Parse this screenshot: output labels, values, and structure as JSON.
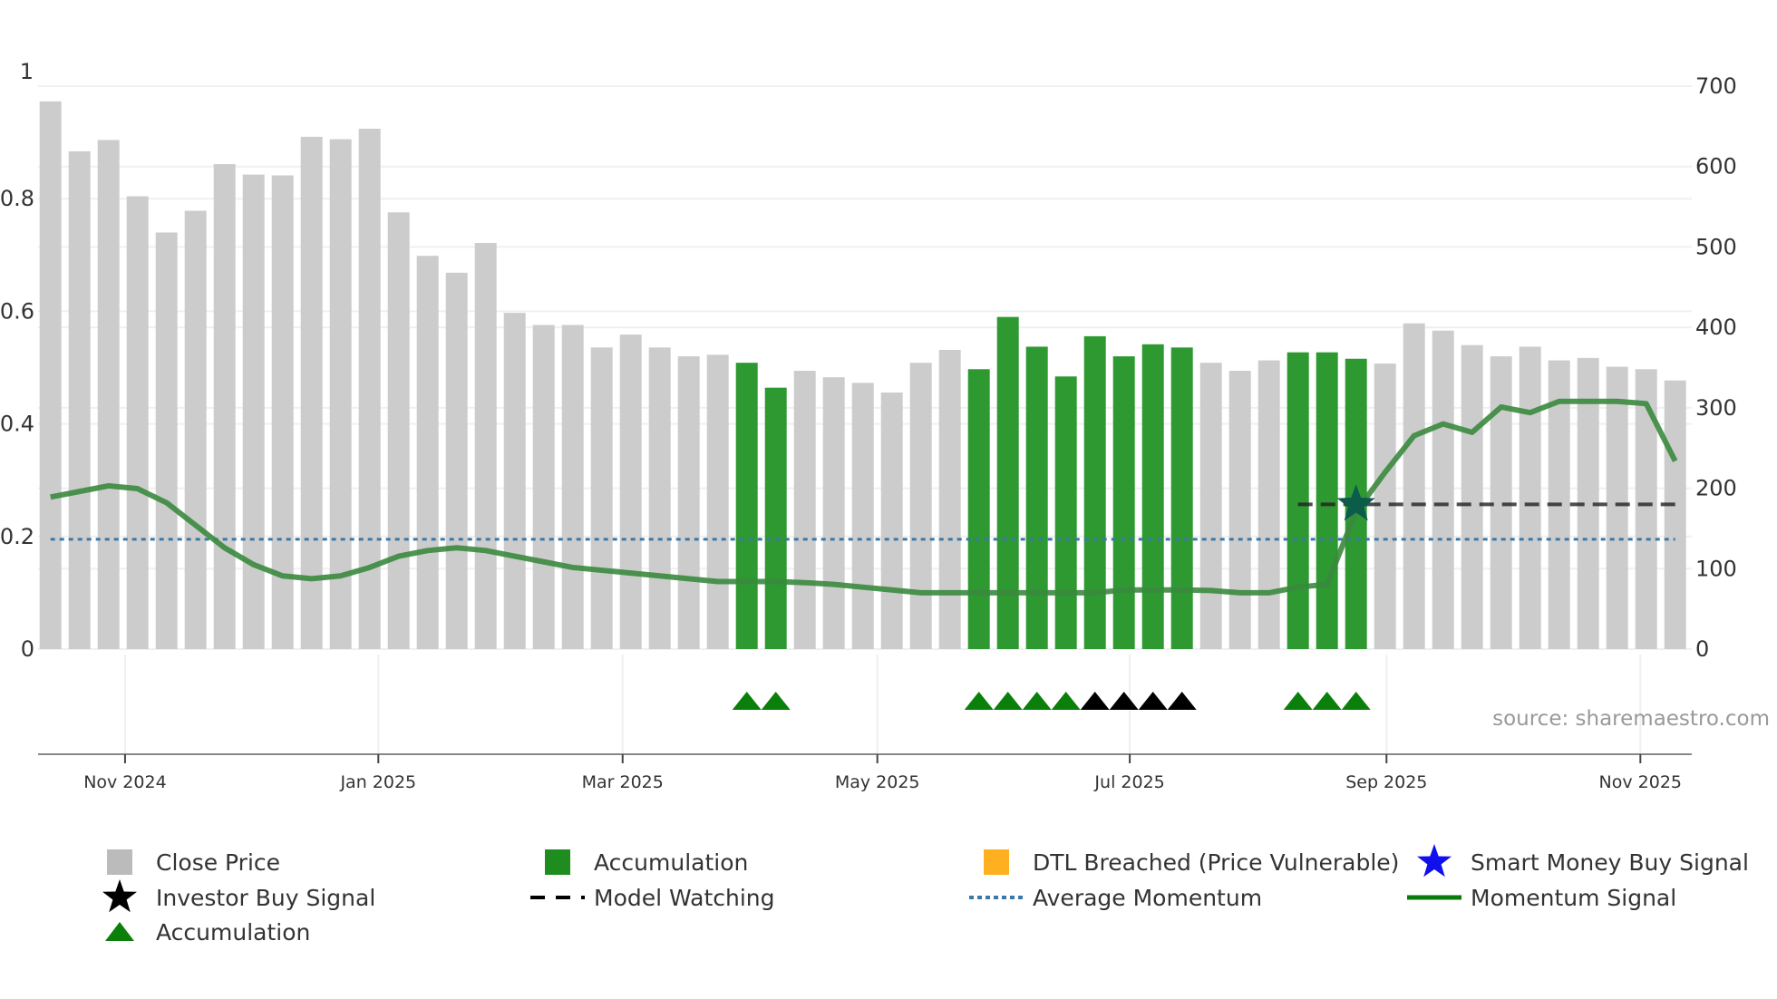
{
  "chart_data": {
    "type": "bar",
    "title": "",
    "xlabel": "",
    "ylabel_left": "",
    "ylabel_right": "",
    "left_axis": {
      "range": [
        0,
        1
      ],
      "ticks": [
        "0",
        "0.2",
        "0.4",
        "0.6",
        "0.8",
        "1"
      ],
      "tick_values": [
        0,
        0.2,
        0.4,
        0.6,
        0.8,
        1
      ]
    },
    "right_axis": {
      "range": [
        0,
        700
      ],
      "ticks": [
        "0",
        "100",
        "200",
        "300",
        "400",
        "500",
        "600",
        "700"
      ],
      "tick_values": [
        0,
        100,
        200,
        300,
        400,
        500,
        600,
        700
      ]
    },
    "x_ticks": [
      {
        "label": "Nov 2024",
        "index": 2.57
      },
      {
        "label": "Jan 2025",
        "index": 11.3
      },
      {
        "label": "Mar 2025",
        "index": 19.72
      },
      {
        "label": "May 2025",
        "index": 28.5
      },
      {
        "label": "Jul 2025",
        "index": 37.2
      },
      {
        "label": "Sep 2025",
        "index": 46.05
      },
      {
        "label": "Nov 2025",
        "index": 54.8
      }
    ],
    "close_price": [
      681,
      619,
      633,
      563,
      518,
      545,
      603,
      590,
      589,
      637,
      634,
      647,
      543,
      489,
      468,
      505,
      418,
      403,
      403,
      375,
      391,
      375,
      364,
      366,
      356,
      325,
      346,
      338,
      331,
      319,
      356,
      372,
      348,
      413,
      376,
      339,
      389,
      364,
      379,
      375,
      356,
      346,
      359,
      369,
      369,
      361,
      355,
      405,
      396,
      378,
      364,
      376,
      359,
      362,
      351,
      348,
      334
    ],
    "accumulation_bars": [
      24,
      25,
      32,
      33,
      34,
      35,
      36,
      37,
      38,
      39,
      43,
      44,
      45
    ],
    "momentum": [
      0.27,
      0.28,
      0.29,
      0.285,
      0.26,
      0.22,
      0.18,
      0.15,
      0.13,
      0.125,
      0.13,
      0.145,
      0.165,
      0.175,
      0.18,
      0.175,
      0.165,
      0.155,
      0.145,
      0.14,
      0.135,
      0.13,
      0.125,
      0.12,
      0.12,
      0.12,
      0.118,
      0.115,
      0.11,
      0.105,
      0.1,
      0.1,
      0.1,
      0.1,
      0.1,
      0.1,
      0.1,
      0.105,
      0.105,
      0.105,
      0.104,
      0.1,
      0.1,
      0.11,
      0.115,
      0.244,
      0.314,
      0.379,
      0.4,
      0.385,
      0.43,
      0.42,
      0.44,
      0.44,
      0.44,
      0.436,
      0.334
    ],
    "average_momentum": 0.195,
    "model_watching": {
      "value": 0.257,
      "from_index": 43,
      "to_index": 56
    },
    "smart_money_buy_signal": [
      {
        "index": 45,
        "value": 0.257
      }
    ],
    "triangle_markers": {
      "green": [
        24,
        25,
        32,
        33,
        34,
        35,
        43,
        44,
        45
      ],
      "black": [
        36,
        37,
        38,
        39
      ]
    },
    "colors": {
      "close_price": "#cccccc",
      "accumulation": "#2e9930",
      "momentum": "#3a8a3e",
      "average_momentum": "#3a78a8",
      "dtl": "#ffb020",
      "smart_money": "#1010ee",
      "triangle_green": "#0a7f0a",
      "triangle_black": "#000000"
    },
    "legend": [
      {
        "label": "Close Price",
        "icon": "gray-square"
      },
      {
        "label": "Accumulation",
        "icon": "green-square"
      },
      {
        "label": "DTL Breached (Price Vulnerable)",
        "icon": "orange-square"
      },
      {
        "label": "Smart Money Buy Signal",
        "icon": "blue-star"
      },
      {
        "label": "Investor Buy Signal",
        "icon": "black-star"
      },
      {
        "label": "Model Watching",
        "icon": "black-dash"
      },
      {
        "label": "Average Momentum",
        "icon": "blue-dots"
      },
      {
        "label": "Momentum Signal",
        "icon": "green-line"
      },
      {
        "label": "Accumulation",
        "icon": "green-triangle"
      }
    ],
    "source": "source: sharemaestro.com"
  }
}
